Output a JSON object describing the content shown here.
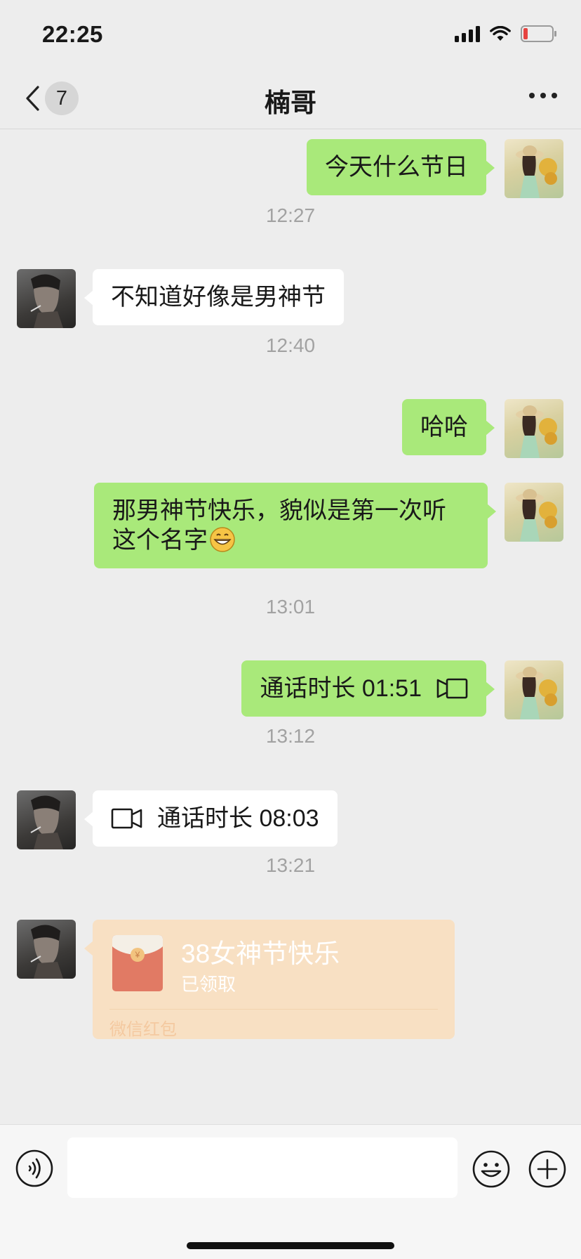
{
  "status_bar": {
    "time": "22:25",
    "icons": [
      "signal-icon",
      "wifi-icon",
      "battery-low-icon"
    ],
    "battery_color": "#e64340"
  },
  "header": {
    "back_icon": "chevron-left-icon",
    "unread_count": "7",
    "title": "楠哥",
    "more_icon": "more-icon"
  },
  "messages": [
    {
      "type": "text",
      "sender": "self",
      "text": "今天什么节日"
    },
    {
      "type": "timestamp",
      "text": "12:27"
    },
    {
      "type": "text",
      "sender": "peer",
      "text": "不知道好像是男神节"
    },
    {
      "type": "timestamp",
      "text": "12:40"
    },
    {
      "type": "text",
      "sender": "self",
      "text": "哈哈"
    },
    {
      "type": "text",
      "sender": "self",
      "text": "那男神节快乐，貌似是第一次听这个名字",
      "emoji": "grinning-face-icon"
    },
    {
      "type": "timestamp",
      "text": "13:01"
    },
    {
      "type": "call",
      "sender": "self",
      "text": "通话时长 01:51",
      "icon": "video-call-icon"
    },
    {
      "type": "timestamp",
      "text": "13:12"
    },
    {
      "type": "call",
      "sender": "peer",
      "text": "通话时长 08:03",
      "icon": "video-call-icon"
    },
    {
      "type": "timestamp",
      "text": "13:21"
    },
    {
      "type": "red_packet",
      "sender": "peer",
      "title": "38女神节快乐",
      "status": "已领取",
      "footer": "微信红包",
      "icon": "red-envelope-icon"
    }
  ],
  "input_bar": {
    "voice_icon": "voice-icon",
    "input_value": "",
    "emoji_icon": "emoji-icon",
    "plus_icon": "plus-icon"
  },
  "colors": {
    "self_bubble": "#a9e97a",
    "peer_bubble": "#ffffff",
    "background": "#ededed",
    "red_packet": "#f8e0c3"
  }
}
